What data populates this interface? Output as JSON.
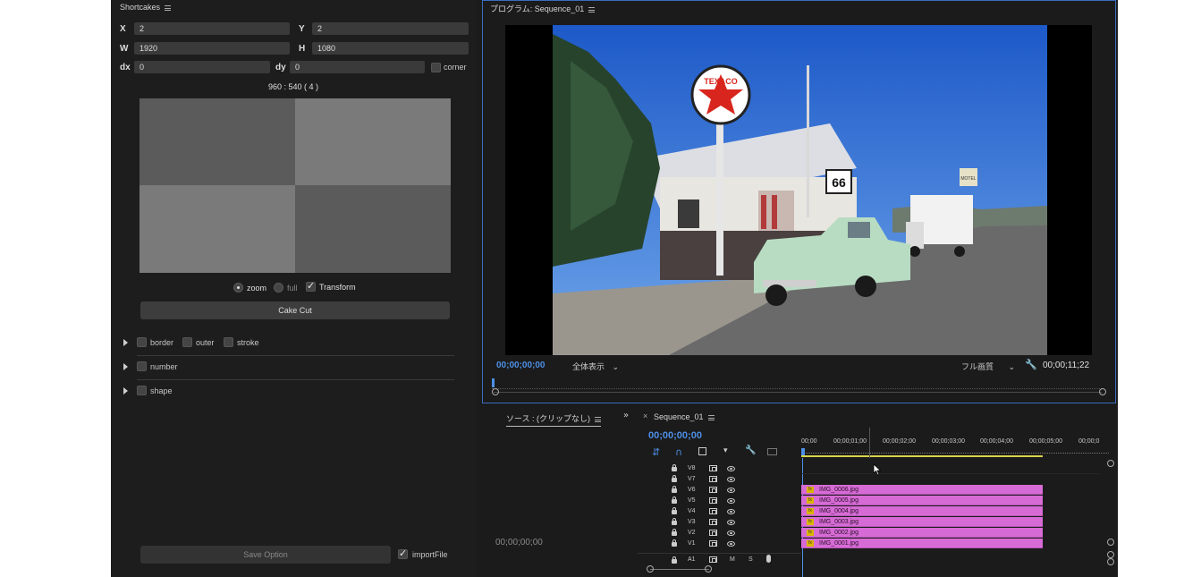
{
  "shortcakes": {
    "title": "Shortcakes",
    "x_label": "X",
    "x_value": "2",
    "y_label": "Y",
    "y_value": "2",
    "w_label": "W",
    "w_value": "1920",
    "h_label": "H",
    "h_value": "1080",
    "dx_label": "dx",
    "dx_value": "0",
    "dy_label": "dy",
    "dy_value": "0",
    "corner_label": "corner",
    "ratio_text": "960 : 540 ( 4 )",
    "zoom_label": "zoom",
    "full_label": "full",
    "transform_label": "Transform",
    "cake_cut_label": "Cake Cut",
    "border_label": "border",
    "outer_label": "outer",
    "stroke_label": "stroke",
    "number_label": "number",
    "shape_label": "shape",
    "save_option_label": "Save Option",
    "import_file_label": "importFile"
  },
  "program": {
    "title": "プログラム: Sequence_01",
    "timecode_current": "00;00;00;00",
    "zoom_select": "全体表示",
    "quality_select": "フル画質",
    "timecode_duration": "00;00;11;22",
    "photo_signs": {
      "texaco": "TEXACO",
      "route": "66",
      "motel": "MOTEL"
    }
  },
  "source": {
    "tab_label": "ソース : (クリップなし)",
    "timecode": "00;00;00;00"
  },
  "timeline": {
    "tab_label": "Sequence_01",
    "timecode": "00;00;00;00",
    "ruler": [
      "00;00",
      "00;00;01;00",
      "00;00;02;00",
      "00;00;03;00",
      "00;00;04;00",
      "00;00;05;00",
      "00;00;0"
    ],
    "video_tracks": [
      "V8",
      "V7",
      "V6",
      "V5",
      "V4",
      "V3",
      "V2",
      "V1"
    ],
    "audio_track": "A1",
    "audio_m": "M",
    "audio_s": "S",
    "clips": [
      "IMG_0006.jpg",
      "IMG_0005.jpg",
      "IMG_0004.jpg",
      "IMG_0003.jpg",
      "IMG_0002.jpg",
      "IMG_0001.jpg"
    ]
  }
}
